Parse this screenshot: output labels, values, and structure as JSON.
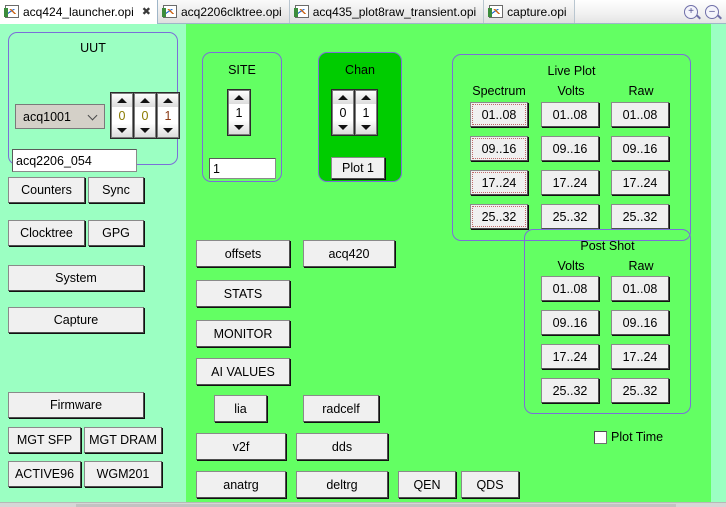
{
  "tabs": [
    {
      "label": "acq424_launcher.opi",
      "active": true,
      "closer": "✖",
      "icon": "opi-file-icon"
    },
    {
      "label": "acq2206clktree.opi",
      "active": false,
      "icon": "opi-file-icon"
    },
    {
      "label": "acq435_plot8raw_transient.opi",
      "active": false,
      "icon": "opi-file-icon"
    },
    {
      "label": "capture.opi",
      "active": false,
      "icon": "opi-file-icon"
    }
  ],
  "tabbar": {
    "zoom_in_icon": "zoom-in-icon",
    "zoom_in_glyph": "+",
    "zoom_out_icon": "zoom-out-icon",
    "zoom_out_glyph": "–"
  },
  "colors": {
    "panel_bg": "#9BFFC2",
    "board_bg": "#63FF63",
    "chan_bg": "#00CC00",
    "group_border": "#7B6FD8",
    "button_face": "#F0F0F0",
    "focus_dots": "#C06A6A"
  },
  "uut": {
    "title": "UUT",
    "combo_value": "acq1001",
    "spinners": [
      {
        "value": "0",
        "color": "#8a7a00"
      },
      {
        "value": "0",
        "color": "#8a7a00"
      },
      {
        "value": "1",
        "color": "#8a3a14"
      }
    ],
    "name_field": "acq2206_054"
  },
  "site": {
    "title": "SITE",
    "spinner": {
      "value": "1",
      "color": "#000000"
    },
    "field": "1"
  },
  "chan": {
    "title": "Chan",
    "spinners": [
      {
        "value": "0",
        "color": "#000000"
      },
      {
        "value": "1",
        "color": "#000000"
      }
    ],
    "plot_button": "Plot 1"
  },
  "live_plot": {
    "title": "Live Plot",
    "columns": [
      {
        "header": "Spectrum",
        "focus": true,
        "buttons": [
          "01..08",
          "09..16",
          "17..24",
          "25..32"
        ]
      },
      {
        "header": "Volts",
        "focus": false,
        "buttons": [
          "01..08",
          "09..16",
          "17..24",
          "25..32"
        ]
      },
      {
        "header": "Raw",
        "focus": false,
        "buttons": [
          "01..08",
          "09..16",
          "17..24",
          "25..32"
        ]
      }
    ]
  },
  "post_shot": {
    "title": "Post Shot",
    "columns": [
      {
        "header": "Volts",
        "buttons": [
          "01..08",
          "09..16",
          "17..24",
          "25..32"
        ]
      },
      {
        "header": "Raw",
        "buttons": [
          "01..08",
          "09..16",
          "17..24",
          "25..32"
        ]
      }
    ],
    "plot_time_label": "Plot Time",
    "plot_time_checked": false
  },
  "sidebar": {
    "buttons": [
      "Counters",
      "Sync",
      "Clocktree",
      "GPG",
      "System",
      "Capture",
      "Firmware",
      "MGT SFP",
      "MGT DRAM",
      "ACTIVE96",
      "WGM201"
    ]
  },
  "board_buttons": {
    "offsets": "offsets",
    "acq420": "acq420",
    "stats": "STATS",
    "monitor": "MONITOR",
    "ai_values": "AI VALUES",
    "lia": "lia",
    "radcelf": "radcelf",
    "v2f": "v2f",
    "dds": "dds",
    "anatrg": "anatrg",
    "deltrg": "deltrg",
    "qen": "QEN",
    "qds": "QDS"
  }
}
